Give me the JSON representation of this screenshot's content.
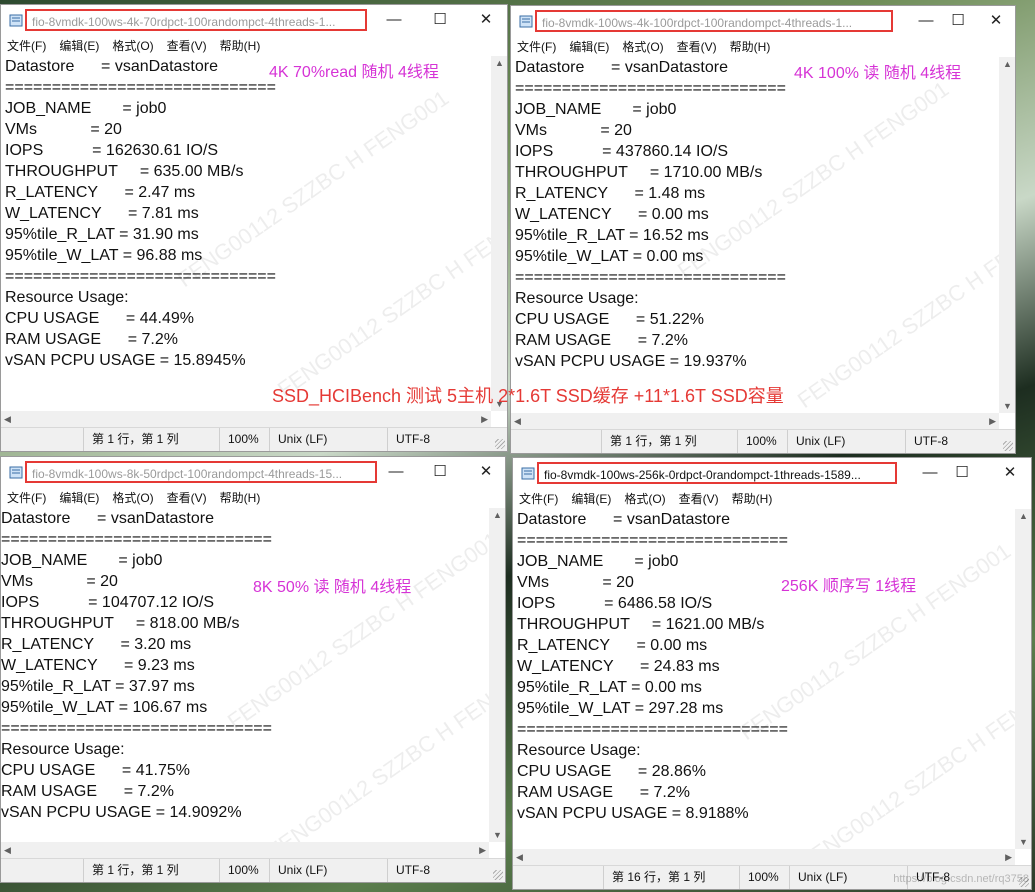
{
  "common": {
    "menu": [
      "文件(F)",
      "编辑(E)",
      "格式(O)",
      "查看(V)",
      "帮助(H)"
    ],
    "zoom": "100%",
    "eol": "Unix (LF)",
    "encoding": "UTF-8",
    "minimize": "—",
    "maximize": "☐",
    "close": "✕"
  },
  "windows": [
    {
      "title": "fio-8vmdk-100ws-4k-70rdpct-100randompct-4threads-1...",
      "position": "第 1 行，第 1 列",
      "annotation": "4K 70%read 随机  4线程",
      "lines": [
        "Datastore      = vsanDatastore",
        "=============================",
        "JOB_NAME       = job0",
        "VMs            = 20",
        "IOPS           = 162630.61 IO/S",
        "THROUGHPUT     = 635.00 MB/s",
        "R_LATENCY      = 2.47 ms",
        "W_LATENCY      = 7.81 ms",
        "95%tile_R_LAT = 31.90 ms",
        "95%tile_W_LAT = 96.88 ms",
        "=============================",
        "Resource Usage:",
        "CPU USAGE      = 44.49%",
        "RAM USAGE      = 7.2%",
        "vSAN PCPU USAGE = 15.8945%"
      ]
    },
    {
      "title": "fio-8vmdk-100ws-4k-100rdpct-100randompct-4threads-1...",
      "position": "第 1 行，第 1 列",
      "annotation": "4K 100% 读 随机 4线程",
      "lines": [
        "Datastore      = vsanDatastore",
        "=============================",
        "JOB_NAME       = job0",
        "VMs            = 20",
        "IOPS           = 437860.14 IO/S",
        "THROUGHPUT     = 1710.00 MB/s",
        "R_LATENCY      = 1.48 ms",
        "W_LATENCY      = 0.00 ms",
        "95%tile_R_LAT = 16.52 ms",
        "95%tile_W_LAT = 0.00 ms",
        "=============================",
        "Resource Usage:",
        "CPU USAGE      = 51.22%",
        "RAM USAGE      = 7.2%",
        "vSAN PCPU USAGE = 19.937%"
      ]
    },
    {
      "title": "fio-8vmdk-100ws-8k-50rdpct-100randompct-4threads-15...",
      "position": "第 1 行，第 1 列",
      "annotation": "8K 50% 读 随机 4线程",
      "lines": [
        "Datastore      = vsanDatastore",
        "=============================",
        "JOB_NAME       = job0",
        "VMs            = 20",
        "IOPS           = 104707.12 IO/S",
        "THROUGHPUT     = 818.00 MB/s",
        "R_LATENCY      = 3.20 ms",
        "W_LATENCY      = 9.23 ms",
        "95%tile_R_LAT = 37.97 ms",
        "95%tile_W_LAT = 106.67 ms",
        "=============================",
        "Resource Usage:",
        "CPU USAGE      = 41.75%",
        "RAM USAGE      = 7.2%",
        "vSAN PCPU USAGE = 14.9092%"
      ]
    },
    {
      "title": "fio-8vmdk-100ws-256k-0rdpct-0randompct-1threads-1589...",
      "position": "第 16 行，第 1 列",
      "annotation": "256K 顺序写 1线程",
      "lines": [
        "Datastore      = vsanDatastore",
        "=============================",
        "JOB_NAME       = job0",
        "VMs            = 20",
        "IOPS           = 6486.58 IO/S",
        "THROUGHPUT     = 1621.00 MB/s",
        "R_LATENCY      = 0.00 ms",
        "W_LATENCY      = 24.83 ms",
        "95%tile_R_LAT = 0.00 ms",
        "95%tile_W_LAT = 297.28 ms",
        "=============================",
        "Resource Usage:",
        "CPU USAGE      = 28.86%",
        "RAM USAGE      = 7.2%",
        "vSAN PCPU USAGE = 8.9188%"
      ]
    }
  ],
  "banner": "SSD_HCIBench 测试 5主机  2*1.6T SSD缓存 +11*1.6T SSD容量",
  "watermark": "FENG00112 SZZBC H FENG001",
  "footer_watermark": "https://blog.csdn.net/rq3758"
}
